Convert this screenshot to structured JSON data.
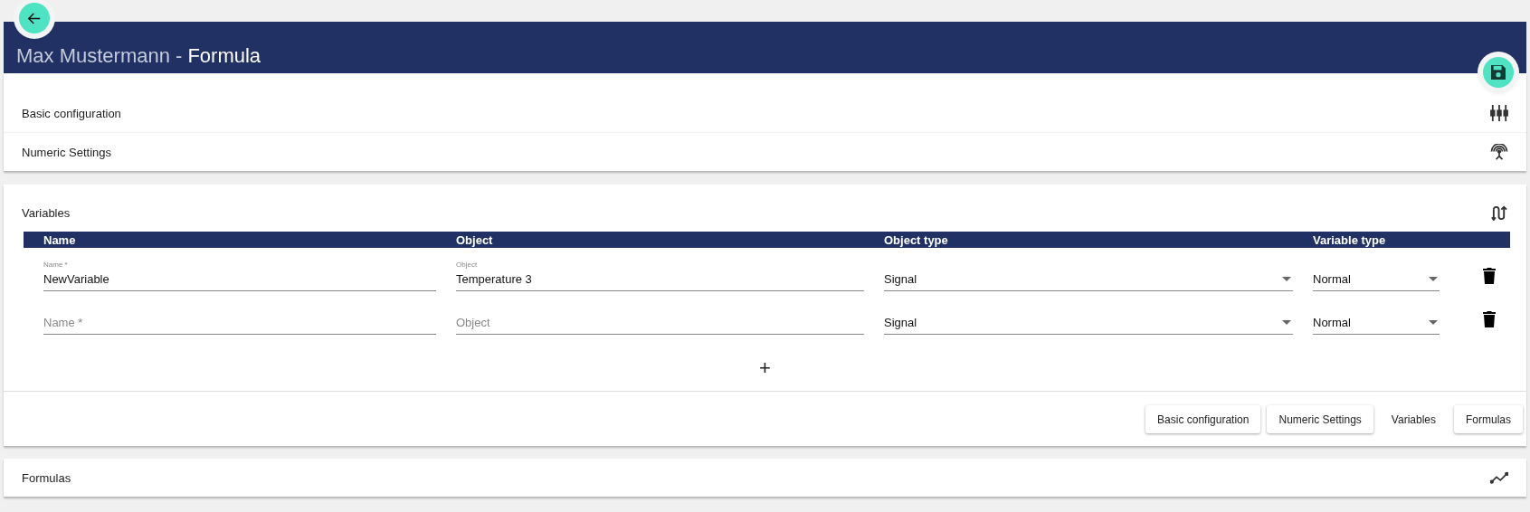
{
  "header": {
    "owner": "Max Mustermann -",
    "title": "Formula"
  },
  "sections": [
    {
      "label": "Basic configuration"
    },
    {
      "label": "Numeric Settings"
    }
  ],
  "variables": {
    "title": "Variables",
    "columns": [
      "Name",
      "Object",
      "Object type",
      "Variable type"
    ],
    "rows": [
      {
        "name": {
          "label": "Name *",
          "value": "NewVariable"
        },
        "object": {
          "label": "Object",
          "value": "Temperature 3"
        },
        "object_type": "Signal",
        "variable_type": "Normal"
      },
      {
        "name": {
          "placeholder": "Name *"
        },
        "object": {
          "placeholder": "Object"
        },
        "object_type": "Signal",
        "variable_type": "Normal"
      }
    ],
    "add_label": "+",
    "nav": [
      {
        "label": "Basic configuration",
        "selected": false
      },
      {
        "label": "Numeric Settings",
        "selected": false
      },
      {
        "label": "Variables",
        "selected": true
      },
      {
        "label": "Formulas",
        "selected": false
      }
    ]
  },
  "formulas": {
    "title": "Formulas"
  }
}
